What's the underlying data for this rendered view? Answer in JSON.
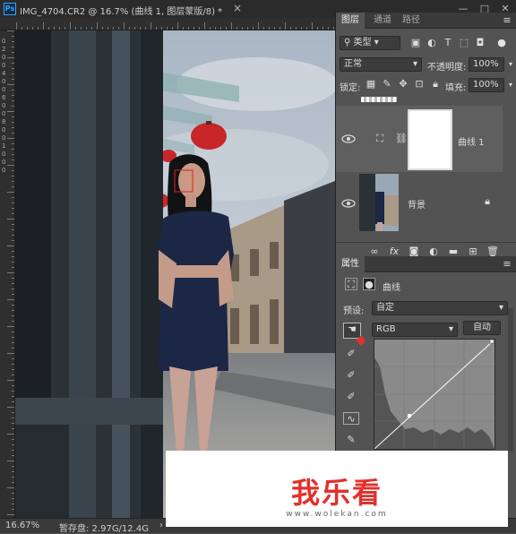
{
  "titlebar": {
    "doc_title": "IMG_4704.CR2 @ 16.7% (曲线 1, 图层蒙版/8) *",
    "close_glyph": "×",
    "win_min": "—",
    "win_max": "□",
    "win_close": "✕"
  },
  "ruler_left_labels": [
    "0",
    "2",
    "0",
    "0",
    "4",
    "0",
    "0",
    "6",
    "0",
    "0",
    "8",
    "0",
    "0",
    "1",
    "0",
    "0",
    "0"
  ],
  "status": {
    "zoom": "16.67%",
    "scratch": "暂存盘: 2.97G/12.4G",
    "arrow": "›"
  },
  "layers_panel": {
    "tabs": [
      "图层",
      "通道",
      "路径"
    ],
    "menu_glyph": "≡",
    "filter_kind": "类型",
    "blend_mode": "正常",
    "opacity_label": "不透明度:",
    "opacity_value": "100%",
    "lock_label": "锁定:",
    "fill_label": "填充:",
    "fill_value": "100%",
    "layers": [
      {
        "name": "曲线 1"
      },
      {
        "name": "背景"
      }
    ],
    "bottom_icons": [
      "link-icon",
      "fx-icon",
      "mask-icon",
      "adjustment-icon",
      "folder-icon",
      "new-layer-icon",
      "trash-icon"
    ],
    "fx_label": "fx"
  },
  "properties_panel": {
    "tab": "属性",
    "title": "曲线",
    "preset_label": "预设:",
    "preset_value": "自定",
    "channel": "RGB",
    "auto_button": "自动"
  },
  "watermark": {
    "title": "我乐看",
    "url": "www.wolekan.com"
  }
}
